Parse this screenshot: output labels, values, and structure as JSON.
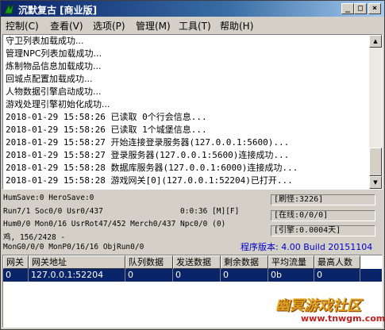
{
  "window": {
    "title": "沉默复古 [商业版]",
    "controls": {
      "minimize": "_",
      "maximize": "□",
      "close": "×"
    }
  },
  "menu": [
    {
      "label": "控制(C)"
    },
    {
      "label": "查看(V)"
    },
    {
      "label": "选项(P)"
    },
    {
      "label": "管理(M)"
    },
    {
      "label": "工具(T)"
    },
    {
      "label": "帮助(H)"
    }
  ],
  "log": [
    "守卫列表加载成功...",
    "管理NPC列表加载成功...",
    "炼制物品信息加载成功...",
    "回城点配置加载成功...",
    "人物数据引擎启动成功...",
    "游戏处理引擎初始化成功...",
    "2018-01-29 15:58:26 已读取 0个行会信息...",
    "2018-01-29 15:58:26 已读取 1个城堡信息...",
    "2018-01-29 15:58:27 开始连接登录服务器(127.0.0.1:5600)...",
    "2018-01-29 15:58:27 登录服务器(127.0.0.1:5600)连接成功...",
    "2018-01-29 15:58:28 数据库服务器(127.0.0.1:6000)连接成功...",
    "2018-01-29 15:58:28 游戏网关[0](127.0.0.1:52204)已打开..."
  ],
  "status": {
    "line1": "HumSave:0 HeroSave:0",
    "line2": "Run7/1 Soc0/0 Usr0/437",
    "timer": "0:0:36 [M][F]",
    "line3": "Hum0/0 Mon0/16 UsrRot47/452 Merch0/437 Npc0/0 (0)",
    "line4": "鸡, 156/2428 -",
    "line5": "MonG0/0/0 MonP0/16/16 ObjRun0/0",
    "refresh": "[刷怪:3226]",
    "online": "[在线:0/0/0]",
    "engine": "[引擎:0.0004天]",
    "version": "程序版本: 4.00 Build 20151104"
  },
  "gateway_table": {
    "columns": [
      "网关",
      "网关地址",
      "队列数据",
      "发送数据",
      "剩余数据",
      "平均流量",
      "最高人数"
    ],
    "rows": [
      [
        "0",
        "127.0.0.1:52204",
        "0",
        "0",
        "0",
        "0b",
        "0"
      ]
    ]
  },
  "watermark": {
    "title": "幽冥游戏社区",
    "url": "www.tnwgm.com"
  }
}
